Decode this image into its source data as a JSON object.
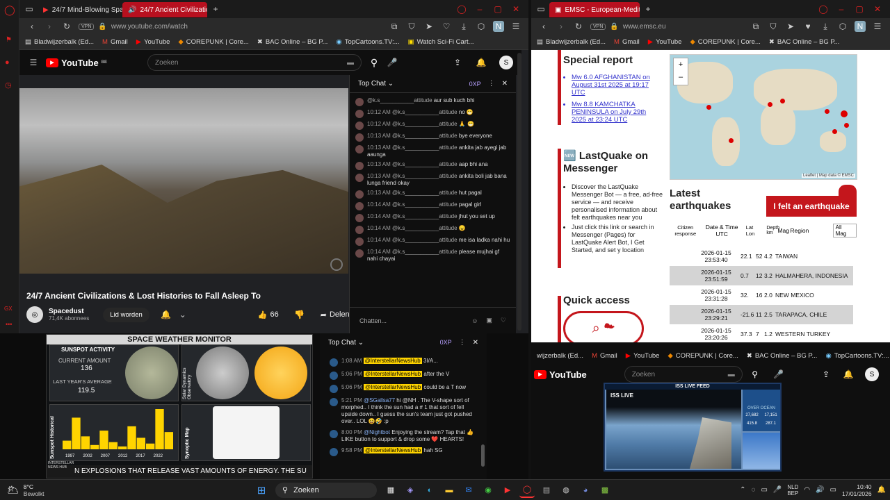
{
  "left_browser": {
    "tabs": [
      {
        "label": "24/7 Mind-Blowing Space"
      },
      {
        "label": "24/7 Ancient Civilizatio"
      }
    ],
    "url": "www.youtube.com/watch",
    "vpn": "VPN",
    "avatar_letter": "N",
    "bookmarks": [
      "Bladwijzerbalk (Ed...",
      "Gmail",
      "YouTube",
      "COREPUNK | Core...",
      "BAC Online – BG P...",
      "TopCartoons.TV:...",
      "Watch Sci-Fi Cart..."
    ]
  },
  "youtube_top": {
    "logo": "YouTube",
    "region": "BE",
    "search_placeholder": "Zoeken",
    "user_initial": "S"
  },
  "video": {
    "title": "24/7 Ancient Civilizations & Lost Histories to Fall Asleep To",
    "channel": "Spacedust",
    "subscribers": "71,4K abonnees",
    "join_label": "Lid worden",
    "likes": "66",
    "share_label": "Delen"
  },
  "chat_top": {
    "header": "Top Chat",
    "xp": "0XP",
    "input_placeholder": "Chatten...",
    "messages": [
      {
        "time": "",
        "user": "@k.s___________attitude",
        "text": "aur sub kuch bhi"
      },
      {
        "time": "10:12 AM",
        "user": "@k.s___________attitude",
        "text": "no 😁"
      },
      {
        "time": "10:12 AM",
        "user": "@k.s___________attitude",
        "text": "🙏 😁"
      },
      {
        "time": "10:13 AM",
        "user": "@k.s___________attitude",
        "text": "bye everyone"
      },
      {
        "time": "10:13 AM",
        "user": "@k.s___________attitude",
        "text": "ankita jab ayegi jab aaunga"
      },
      {
        "time": "10:13 AM",
        "user": "@k.s___________attitude",
        "text": "aap bhi ana"
      },
      {
        "time": "10:13 AM",
        "user": "@k.s___________attitude",
        "text": "ankita boli jab bana lunga friend okay"
      },
      {
        "time": "10:13 AM",
        "user": "@k.s___________attitude",
        "text": "hut pagal"
      },
      {
        "time": "10:14 AM",
        "user": "@k.s___________attitude",
        "text": "pagal girl"
      },
      {
        "time": "10:14 AM",
        "user": "@k.s___________attitude",
        "text": "jhut you set up"
      },
      {
        "time": "10:14 AM",
        "user": "@k.s___________attitude",
        "text": "😠"
      },
      {
        "time": "10:14 AM",
        "user": "@k.s___________attitude",
        "text": "me isa ladka nahi hu"
      },
      {
        "time": "10:14 AM",
        "user": "@k.s___________attitude",
        "text": "please mujhai gf nahi chayai"
      }
    ]
  },
  "right_browser": {
    "tab": "EMSC - European-Mediter",
    "url": "www.emsc.eu",
    "bookmarks": [
      "Bladwijzerbalk (Ed...",
      "Gmail",
      "YouTube",
      "COREPUNK | Core...",
      "BAC Online – BG P..."
    ],
    "special_report": "Special report",
    "report_links": [
      "Mw 6.0 AFGHANISTAN on August 31st 2025 at 19:17 UTC",
      "Mw 8.8 KAMCHATKA PENINSULA on July 29th 2025 at 23:24 UTC"
    ],
    "lastquake_title": "🆕 LastQuake on Messenger",
    "lastquake_bullets": [
      "Discover the LastQuake Messenger Bot — a free, ad-free service — and receive personalised information about felt earthquakes near you",
      "Just click this link or search in Messenger (Pages) for LastQuake Alert Bot, I Get Started, and set y location"
    ],
    "quick_access": "Quick access",
    "map_attribution": "Leaflet | Map data © EMSC",
    "latest_title": "Latest earthquakes",
    "felt_button": "I felt an earthquake",
    "table_headers": [
      "Citizen response",
      "Date & Time UTC",
      "Lat Lon",
      "Depth km",
      "Mag",
      "Region"
    ],
    "mag_filter": "All Mag",
    "quakes": [
      {
        "date": "2026-01-15",
        "time": "23:53:40",
        "lat": "22.1",
        "lon": "52",
        "mag": "4.2",
        "region": "TAIWAN"
      },
      {
        "date": "2026-01-15",
        "time": "23:51:59",
        "lat": "0.7",
        "lon": "12",
        "mag": "3.2",
        "region": "HALMAHERA, INDONESIA"
      },
      {
        "date": "2026-01-15",
        "time": "23:31:28",
        "lat": "32.",
        "lon": "16",
        "mag": "2.0",
        "region": "NEW MEXICO"
      },
      {
        "date": "2026-01-15",
        "time": "23:29:21",
        "lat": "-21.6",
        "lon": "11",
        "mag": "2.5",
        "region": "TARAPACA, CHILE"
      },
      {
        "date": "2026-01-15",
        "time": "23:20:26",
        "lat": "37.3",
        "lon": "7",
        "mag": "1.2",
        "region": "WESTERN TURKEY"
      }
    ]
  },
  "space_weather": {
    "title": "SPACE WEATHER MONITOR",
    "sunspot_activity": "SUNSPOT ACTIVITY",
    "current_amount_label": "CURRENT AMOUNT",
    "current_amount": "136",
    "last_year_label": "LAST YEAR'S AVERAGE",
    "last_year_avg": "119.5",
    "sdo_label": "Solar Dynamics Observatory",
    "historical_label": "Sunspot Historical",
    "synoptic_label": "Synoptic Map",
    "ticker": "N EXPLOSIONS THAT RELEASE VAST AMOUNTS OF ENERGY.   THE SU",
    "logo": "INTERSTELLAR NEWS HUB"
  },
  "space_weather_chart": {
    "type": "bar",
    "categories": [
      "1997",
      "2002",
      "2007",
      "2012",
      "2017",
      "2022"
    ],
    "values": [
      30,
      110,
      45,
      15,
      65,
      25,
      10,
      80,
      40,
      20,
      140,
      60
    ],
    "color": "#ffd400"
  },
  "chat_bottom": {
    "header": "Top Chat",
    "xp": "0XP",
    "messages": [
      {
        "time": "1:08 AM",
        "user": "@InterstellarNewsHub",
        "text": "3I/A..."
      },
      {
        "time": "5:06 PM",
        "user": "@InterstellarNewsHub",
        "text": "after the V"
      },
      {
        "time": "5:06 PM",
        "user": "@InterstellarNewsHub",
        "text": "could be a T now"
      },
      {
        "time": "5:21 PM",
        "user": "@SGallsa77",
        "text": "hi @NH . The V-shape sort of morphed.. I think the sun had a # 1 that sort of fell upside down.. I guess the sun's team just got pushed over.. LOL 😄🤣 :p"
      },
      {
        "time": "8:00 PM",
        "user": "@Nightbot",
        "text": "Enjoying the stream? Tap that 👍 LIKE button to support & drop some ❤️ HEARTS!"
      },
      {
        "time": "9:58 PM",
        "user": "@InterstellarNewsHub",
        "text": "hah SG"
      }
    ]
  },
  "bottom_right": {
    "bookmarks": [
      "wijzerbalk (Ed...",
      "Gmail",
      "YouTube",
      "COREPUNK | Core...",
      "BAC Online – BG P...",
      "TopCartoons.TV:..."
    ],
    "search_placeholder": "Zoeken",
    "user_initial": "S",
    "iss_banner": "ISS LIVE FEED",
    "iss_label": "ISS LIVE",
    "iss_panel": "OVER OCEAN",
    "iss_nums": [
      "27,682",
      "17,151",
      "415.8",
      "287.1"
    ]
  },
  "taskbar": {
    "weather_temp": "8°C",
    "weather_desc": "Bewolkt",
    "search": "Zoeken",
    "lang1": "NLD",
    "lang2": "BEP",
    "time": "10:40",
    "date": "17/01/2026"
  }
}
